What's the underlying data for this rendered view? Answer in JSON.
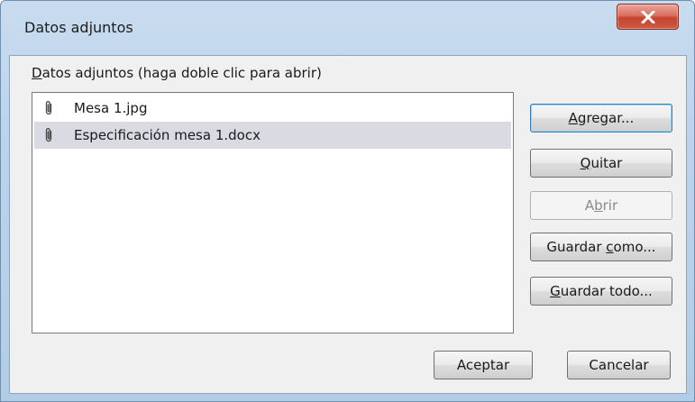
{
  "window": {
    "title": "Datos adjuntos"
  },
  "attachments": {
    "label": "Datos adjuntos (haga doble clic para abrir)",
    "items": [
      {
        "name": "Mesa 1.jpg",
        "selected": false
      },
      {
        "name": "Especificación mesa 1.docx",
        "selected": true
      }
    ]
  },
  "buttons": {
    "add": "Agregar...",
    "remove": "Quitar",
    "open": "Abrir",
    "save_as": "Guardar como...",
    "save_all": "Guardar todo...",
    "ok": "Aceptar",
    "cancel": "Cancelar"
  },
  "colors": {
    "close_button": "#c4442f",
    "selection": "#dadae3",
    "default_button_border": "#3c7fb1"
  },
  "icons": {
    "close": "close-icon",
    "attachment": "paperclip-icon"
  }
}
